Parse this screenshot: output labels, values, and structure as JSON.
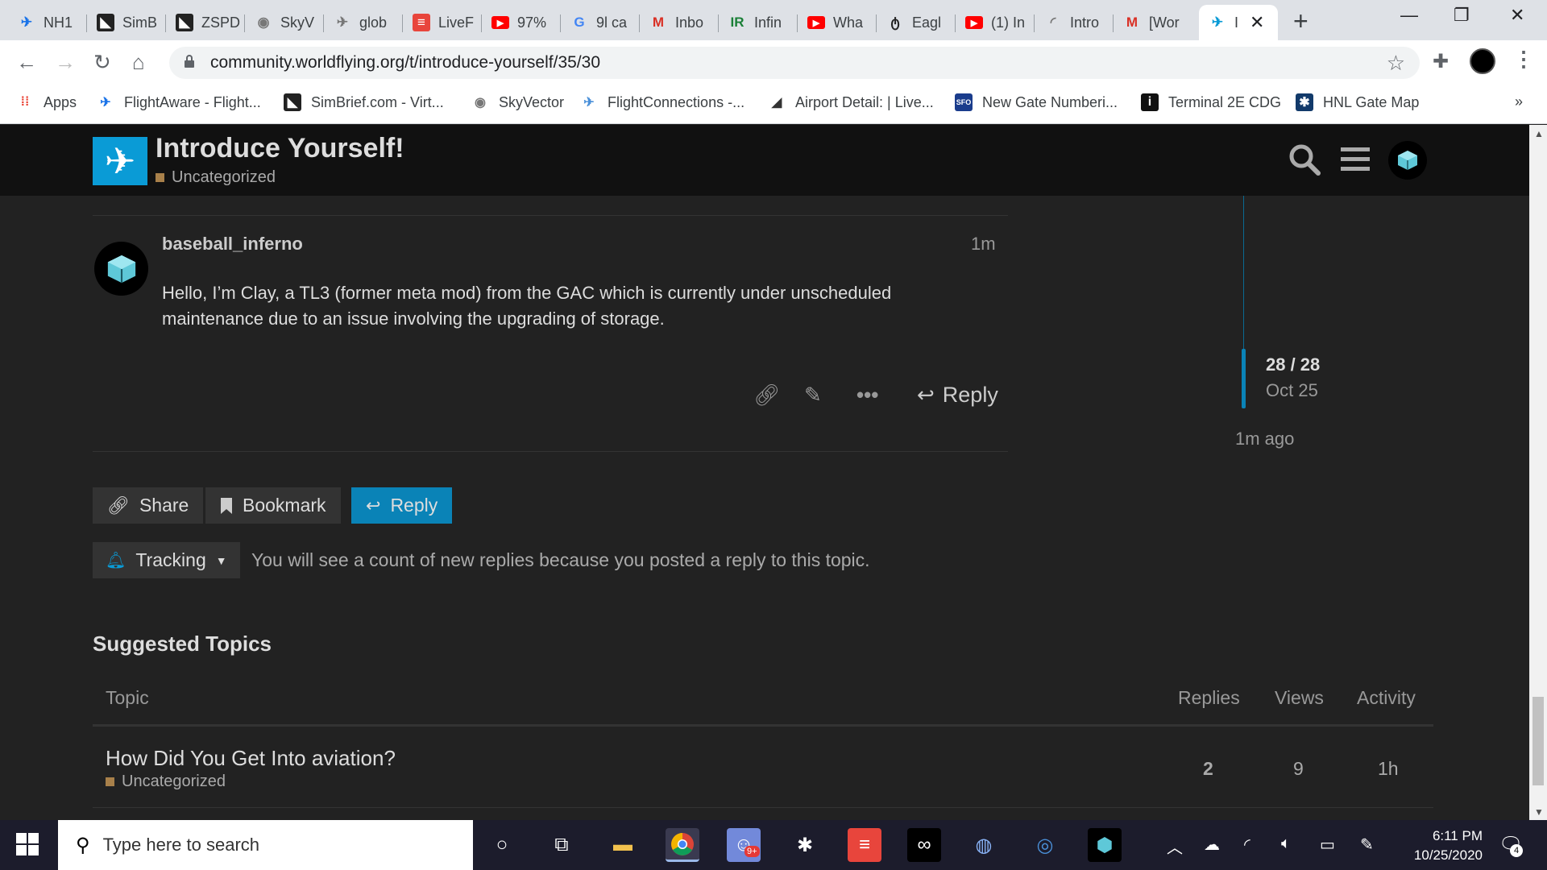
{
  "browser": {
    "tabs": [
      {
        "title": "NH1",
        "icon": "plane-icon",
        "color": "#1a73e8"
      },
      {
        "title": "SimB",
        "icon": "simbrief-icon",
        "color": "#222222"
      },
      {
        "title": "ZSPD",
        "icon": "simbrief-icon",
        "color": "#222222"
      },
      {
        "title": "SkyV",
        "icon": "globe-icon",
        "color": "#777777"
      },
      {
        "title": "glob",
        "icon": "plane-icon",
        "color": "#777777"
      },
      {
        "title": "LiveF",
        "icon": "liveflight-icon",
        "color": "#e8453c"
      },
      {
        "title": "97%",
        "icon": "youtube-icon",
        "color": "#ff0000"
      },
      {
        "title": "9l ca",
        "icon": "google-icon",
        "color": "#4285f4"
      },
      {
        "title": "Inbo",
        "icon": "gmail-icon",
        "color": "#d93025"
      },
      {
        "title": "Infin",
        "icon": "ir-icon",
        "color": "#1a7f37"
      },
      {
        "title": "Wha",
        "icon": "youtube-icon",
        "color": "#ff0000"
      },
      {
        "title": "Eagl",
        "icon": "eagle-icon",
        "color": "#222222"
      },
      {
        "title": "(1) In",
        "icon": "youtube-icon",
        "color": "#ff0000"
      },
      {
        "title": "Intro",
        "icon": "loading-icon",
        "color": "#777777"
      },
      {
        "title": "[Wor",
        "icon": "gmail-icon",
        "color": "#d93025"
      },
      {
        "title": "I",
        "icon": "plane-icon",
        "color": "#0a9bd6",
        "active": true
      }
    ],
    "url": "community.worldflying.org/t/introduce-yourself/35/30",
    "bookmarks": [
      {
        "label": "Apps",
        "icon": "apps-grid-icon"
      },
      {
        "label": "FlightAware - Flight...",
        "icon": "plane-icon"
      },
      {
        "label": "SimBrief.com - Virt...",
        "icon": "simbrief-icon"
      },
      {
        "label": "SkyVector",
        "icon": "globe-icon"
      },
      {
        "label": "FlightConnections -...",
        "icon": "flightconnections-icon"
      },
      {
        "label": "Airport Detail: | Live...",
        "icon": "signal-icon"
      },
      {
        "label": "New Gate Numberi...",
        "icon": "sfo-icon"
      },
      {
        "label": "Terminal 2E CDG",
        "icon": "info-icon"
      },
      {
        "label": "HNL Gate Map",
        "icon": "star-badge-icon"
      }
    ],
    "more": "»"
  },
  "header": {
    "title": "Introduce Yourself!",
    "category": "Uncategorized",
    "category_color": "#a8804a"
  },
  "post": {
    "username": "baseball_inferno",
    "age": "1m",
    "body": "Hello, I’m Clay, a TL3 (former meta mod) from the GAC which is currently under unscheduled maintenance due to an issue involving the upgrading of storage.",
    "reply_label": "Reply"
  },
  "timeline": {
    "count": "28 / 28",
    "date": "Oct 25",
    "ago": "1m ago"
  },
  "footer": {
    "share": "Share",
    "bookmark": "Bookmark",
    "reply": "Reply",
    "tracking": "Tracking",
    "tracking_text": "You will see a count of new replies because you posted a reply to this topic."
  },
  "suggested": {
    "heading": "Suggested Topics",
    "columns": {
      "topic": "Topic",
      "replies": "Replies",
      "views": "Views",
      "activity": "Activity"
    },
    "rows": [
      {
        "title": "How Did You Get Into aviation?",
        "category": "Uncategorized",
        "replies": "2",
        "views": "9",
        "activity": "1h"
      }
    ]
  },
  "taskbar": {
    "search_placeholder": "Type here to search",
    "time": "6:11 PM",
    "date": "10/25/2020",
    "notifications": "4",
    "discord_badge": "9+"
  },
  "colors": {
    "accent": "#0a83b7",
    "header_bg": "#111111",
    "page_bg": "#222222"
  }
}
